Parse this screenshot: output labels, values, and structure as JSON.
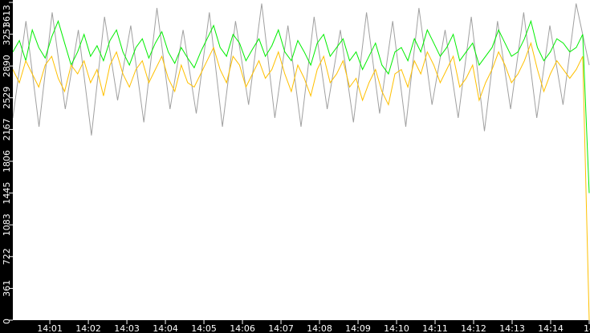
{
  "chart_data": {
    "type": "line",
    "title": "",
    "xlabel": "",
    "ylabel": "",
    "ylim": [
      0,
      3613
    ],
    "xlim_minutes_after_14_00": [
      0.04,
      15.0
    ],
    "y_ticks": [
      "0",
      "361",
      "722",
      "1083",
      "1445",
      "1806",
      "2167",
      "2529",
      "2890",
      "3251",
      "3613"
    ],
    "x_ticks": [
      "14:01",
      "14:02",
      "14:03",
      "14:04",
      "14:05",
      "14:06",
      "14:07",
      "14:08",
      "14:09",
      "14:10",
      "14:11",
      "14:12",
      "14:13",
      "14:14",
      "14"
    ],
    "grid": false,
    "series": [
      {
        "name": "gray",
        "color": "#a0a0a0",
        "values": [
          2300,
          3400,
          2200,
          3500,
          2400,
          3300,
          2100,
          3450,
          2500,
          3350,
          2250,
          3550,
          2400,
          3300,
          2350,
          3500,
          2200,
          3400,
          2450,
          3600,
          2300,
          3350,
          2200,
          3450,
          2400,
          3300,
          2250,
          3500,
          2350,
          3400,
          2200,
          3550,
          2450,
          3300,
          2300,
          3450,
          2150,
          3400,
          2400,
          3500,
          2300,
          3350,
          2450,
          3600,
          2900
        ]
      },
      {
        "name": "green",
        "color": "#00ee00",
        "values": [
          3050,
          3180,
          2950,
          3300,
          3100,
          2980,
          3220,
          3400,
          3150,
          2900,
          3050,
          3250,
          3000,
          3120,
          2950,
          3180,
          3300,
          3050,
          2900,
          3100,
          3200,
          2980,
          3150,
          3280,
          3050,
          2920,
          3100,
          2980,
          2870,
          3050,
          3200,
          3350,
          3100,
          3000,
          3250,
          3150,
          2950,
          3080,
          3200,
          3000,
          3120,
          3300,
          3050,
          2950,
          3180,
          3050,
          2900,
          3150,
          3250,
          3000,
          3100,
          3200,
          2950,
          3050,
          2850,
          3000,
          3150,
          2900,
          2800,
          3050,
          3100,
          2950,
          3200,
          3050,
          3300,
          3150,
          3000,
          3100,
          3250,
          2950,
          3050,
          3150,
          2900,
          3000,
          3100,
          3300,
          3150,
          3000,
          3050,
          3200,
          3400,
          3100,
          2950,
          3050,
          3200,
          3150,
          3050,
          3100,
          3250,
          1445
        ]
      },
      {
        "name": "orange",
        "color": "#ffc000",
        "values": [
          2850,
          2700,
          2950,
          2800,
          2650,
          2900,
          3000,
          2750,
          2600,
          2900,
          2800,
          2950,
          2700,
          2850,
          2550,
          2900,
          3050,
          2800,
          2650,
          2850,
          2950,
          2700,
          2850,
          3000,
          2750,
          2600,
          2900,
          2700,
          2650,
          2800,
          2950,
          3100,
          2850,
          2700,
          3000,
          2900,
          2650,
          2800,
          2950,
          2750,
          2850,
          3050,
          2800,
          2600,
          2900,
          2750,
          2550,
          2850,
          3000,
          2700,
          2800,
          2950,
          2650,
          2750,
          2500,
          2700,
          2850,
          2600,
          2450,
          2800,
          2850,
          2650,
          2950,
          2800,
          3050,
          2900,
          2700,
          2850,
          3000,
          2650,
          2750,
          2900,
          2500,
          2700,
          2850,
          3050,
          2900,
          2700,
          2800,
          2950,
          3150,
          2850,
          2600,
          2800,
          2950,
          2850,
          2750,
          2850,
          3000,
          0
        ]
      }
    ]
  }
}
